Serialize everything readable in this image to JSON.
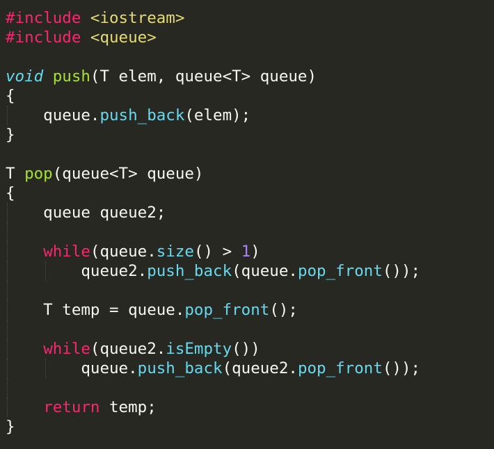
{
  "theme": {
    "background": "#272822",
    "foreground": "#F8F8F2",
    "keyword": "#F92672",
    "string": "#E6DB74",
    "function": "#A6E22E",
    "storage": "#66D9EF",
    "number": "#AE81FF"
  },
  "code_lines": [
    {
      "guides": 0,
      "tokens": [
        {
          "t": "preproc",
          "v": "#include"
        },
        {
          "t": "plain",
          "v": " "
        },
        {
          "t": "string",
          "v": "<iostream>"
        }
      ]
    },
    {
      "guides": 0,
      "tokens": [
        {
          "t": "preproc",
          "v": "#include"
        },
        {
          "t": "plain",
          "v": " "
        },
        {
          "t": "string",
          "v": "<queue>"
        }
      ]
    },
    {
      "guides": 0,
      "tokens": []
    },
    {
      "guides": 0,
      "tokens": [
        {
          "t": "storage",
          "v": "void"
        },
        {
          "t": "plain",
          "v": " "
        },
        {
          "t": "func",
          "v": "push"
        },
        {
          "t": "plain",
          "v": "(T elem, queue<T> queue)"
        }
      ]
    },
    {
      "guides": 0,
      "tokens": [
        {
          "t": "plain",
          "v": "{"
        }
      ]
    },
    {
      "guides": 1,
      "tokens": [
        {
          "t": "plain",
          "v": "    queue."
        },
        {
          "t": "call",
          "v": "push_back"
        },
        {
          "t": "plain",
          "v": "(elem);"
        }
      ]
    },
    {
      "guides": 0,
      "tokens": [
        {
          "t": "plain",
          "v": "}"
        }
      ]
    },
    {
      "guides": 0,
      "tokens": []
    },
    {
      "guides": 0,
      "tokens": [
        {
          "t": "plain",
          "v": "T "
        },
        {
          "t": "func",
          "v": "pop"
        },
        {
          "t": "plain",
          "v": "(queue<T> queue)"
        }
      ]
    },
    {
      "guides": 0,
      "tokens": [
        {
          "t": "plain",
          "v": "{"
        }
      ]
    },
    {
      "guides": 1,
      "tokens": [
        {
          "t": "plain",
          "v": "    queue queue2;"
        }
      ]
    },
    {
      "guides": 1,
      "tokens": []
    },
    {
      "guides": 1,
      "tokens": [
        {
          "t": "plain",
          "v": "    "
        },
        {
          "t": "keyword",
          "v": "while"
        },
        {
          "t": "plain",
          "v": "(queue."
        },
        {
          "t": "call",
          "v": "size"
        },
        {
          "t": "plain",
          "v": "() > "
        },
        {
          "t": "number",
          "v": "1"
        },
        {
          "t": "plain",
          "v": ")"
        }
      ]
    },
    {
      "guides": 2,
      "tokens": [
        {
          "t": "plain",
          "v": "        queue2."
        },
        {
          "t": "call",
          "v": "push_back"
        },
        {
          "t": "plain",
          "v": "(queue."
        },
        {
          "t": "call",
          "v": "pop_front"
        },
        {
          "t": "plain",
          "v": "());"
        }
      ]
    },
    {
      "guides": 1,
      "tokens": []
    },
    {
      "guides": 1,
      "tokens": [
        {
          "t": "plain",
          "v": "    T temp = queue."
        },
        {
          "t": "call",
          "v": "pop_front"
        },
        {
          "t": "plain",
          "v": "();"
        }
      ]
    },
    {
      "guides": 1,
      "tokens": []
    },
    {
      "guides": 1,
      "tokens": [
        {
          "t": "plain",
          "v": "    "
        },
        {
          "t": "keyword",
          "v": "while"
        },
        {
          "t": "plain",
          "v": "(queue2."
        },
        {
          "t": "call",
          "v": "isEmpty"
        },
        {
          "t": "plain",
          "v": "())"
        }
      ]
    },
    {
      "guides": 2,
      "tokens": [
        {
          "t": "plain",
          "v": "        queue."
        },
        {
          "t": "call",
          "v": "push_back"
        },
        {
          "t": "plain",
          "v": "(queue2."
        },
        {
          "t": "call",
          "v": "pop_front"
        },
        {
          "t": "plain",
          "v": "());"
        }
      ]
    },
    {
      "guides": 1,
      "tokens": []
    },
    {
      "guides": 1,
      "tokens": [
        {
          "t": "plain",
          "v": "    "
        },
        {
          "t": "keyword",
          "v": "return"
        },
        {
          "t": "plain",
          "v": " temp;"
        }
      ]
    },
    {
      "guides": 0,
      "tokens": [
        {
          "t": "plain",
          "v": "}"
        }
      ]
    }
  ]
}
